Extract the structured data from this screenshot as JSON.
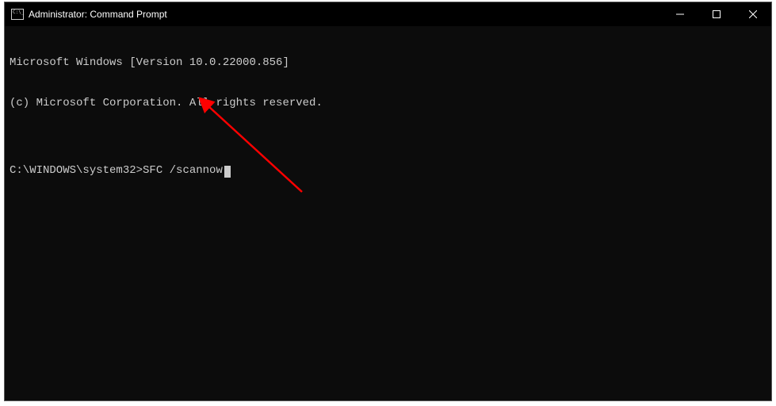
{
  "titlebar": {
    "title": "Administrator: Command Prompt"
  },
  "terminal": {
    "line1": "Microsoft Windows [Version 10.0.22000.856]",
    "line2": "(c) Microsoft Corporation. All rights reserved.",
    "blank": "",
    "prompt": "C:\\WINDOWS\\system32>",
    "command": "SFC /scannow"
  },
  "annotation": {
    "arrow_color": "#ff0000"
  }
}
